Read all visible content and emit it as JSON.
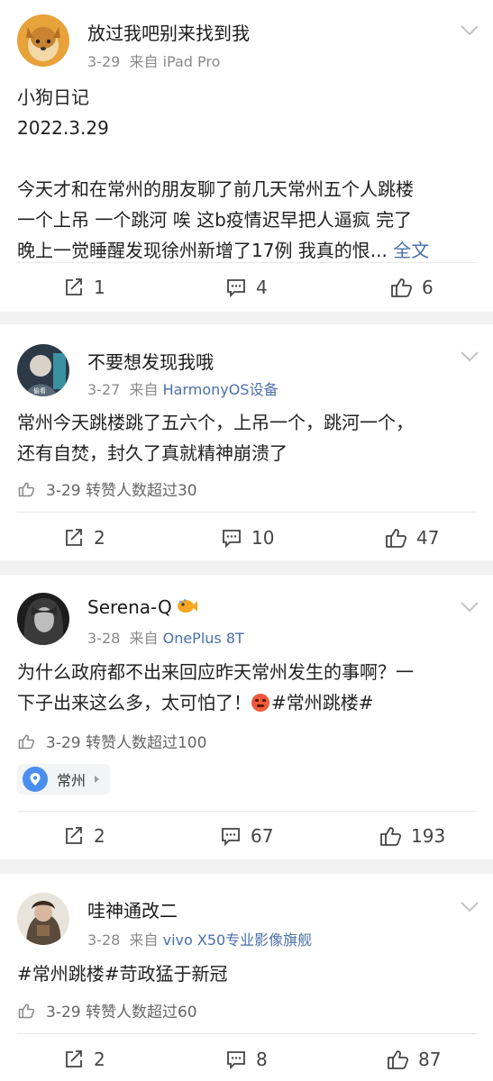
{
  "posts": [
    {
      "username": "放过我吧别来找到我",
      "date": "3-29",
      "via": "来自",
      "source": "iPad Pro",
      "lines": [
        "小狗日记",
        "2022.3.29",
        "",
        "今天才和在常州的朋友聊了前几天常州五个人跳楼",
        "一个上吊 一个跳河 唉 这b疫情迟早把人逼疯 完了"
      ],
      "last_line": "晚上一觉睡醒发现徐州新增了17例 我真的恨...",
      "more_label": "全文",
      "reposts": "1",
      "comments": "4",
      "likes": "6"
    },
    {
      "username": "不要想发现我哦",
      "date": "3-27",
      "via": "来自",
      "source": "HarmonyOS设备",
      "lines": [
        "常州今天跳楼跳了五六个，上吊一个，跳河一个，",
        "还有自焚，封久了真就精神崩溃了"
      ],
      "like_info": "3-29 转赞人数超过30",
      "reposts": "2",
      "comments": "10",
      "likes": "47"
    },
    {
      "username": "Serena-Q",
      "date": "3-28",
      "via": "来自",
      "source": "OnePlus 8T",
      "lines": [
        "为什么政府都不出来回应昨天常州发生的事啊？一"
      ],
      "line2_text": "下子出来这么多，太可怕了！",
      "line2_tag": "#常州跳楼#",
      "like_info": "3-29 转赞人数超过100",
      "location": "常州",
      "reposts": "2",
      "comments": "67",
      "likes": "193"
    },
    {
      "username": "哇神通改二",
      "date": "3-28",
      "via": "来自",
      "source": "vivo X50专业影像旗舰",
      "tags": "#常州跳楼#苛政猛于新冠",
      "like_info": "3-29 转赞人数超过60",
      "reposts": "2",
      "comments": "8",
      "likes": "87"
    }
  ],
  "colors": {
    "link": "#4b70a8",
    "separator": "#f2f2f2",
    "meta": "#8a8a8a"
  }
}
